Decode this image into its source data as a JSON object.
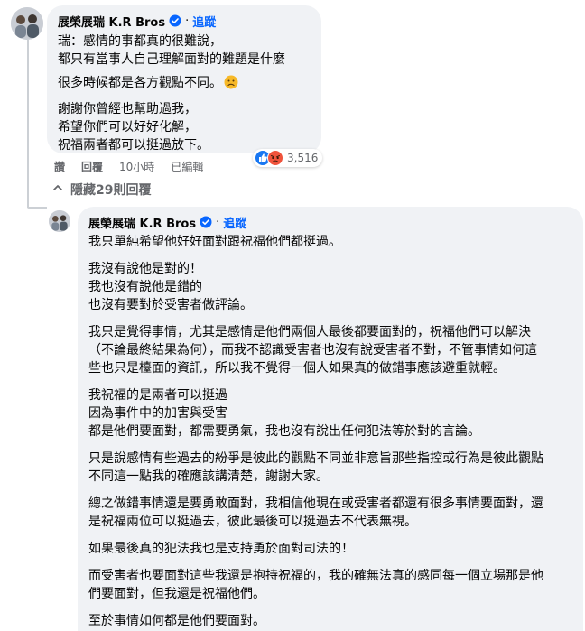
{
  "comment": {
    "author": "展榮展瑞 K.R Bros",
    "follow_label": "追蹤",
    "separator": "·",
    "paragraphs": [
      "瑞：感情的事都真的很難說，\n都只有當事人自己理解面對的難題是什麼",
      "很多時候都是各方觀點不同。",
      "謝謝你曾經也幫助過我，\n希望你們可以好好化解，\n祝福兩者都可以挺過放下。"
    ],
    "reaction_count": "3,516",
    "actions": [
      "讚",
      "回覆",
      "10小時",
      "已編輯"
    ]
  },
  "hidden_replies_label": "隱藏29則回覆",
  "reply": {
    "author": "展榮展瑞 K.R Bros",
    "follow_label": "追蹤",
    "separator": "·",
    "paragraphs": [
      "我只單純希望他好好面對跟祝福他們都挺過。",
      "我沒有說他是對的！\n我也沒有說他是錯的\n也沒有要對於受害者做評論。",
      "我只是覺得事情，尤其是感情是他們兩個人最後都要面對的，祝福他們可以解決\n（不論最終結果為何），而我不認識受害者也沒有說受害者不對，不管事情如何這\n些也只是檯面的資訊，所以我不覺得一個人如果真的做錯事應該避重就輕。",
      "我祝福的是兩者可以挺過\n因為事件中的加害與受害\n都是他們要面對，都需要勇氣，我也沒有說出任何犯法等於對的言論。",
      "只是說感情有些過去的紛爭是彼此的觀點不同並非意旨那些指控或行為是彼此觀點\n不同這一點我的確應該講清楚，謝謝大家。",
      "總之做錯事情還是要勇敢面對，我相信他現在或受害者都還有很多事情要面對，還\n是祝福兩位可以挺過去，彼此最後可以挺過去不代表無視。",
      "如果最後真的犯法我也是支持勇於面對司法的！",
      "而受害者也要面對這些我還是抱持祝福的，我的確無法真的感同每一個立場那是他\n們要面對，但我還是祝福他們。",
      "至於事情如何都是他們要面對。"
    ]
  },
  "colors": {
    "bubble": "#f0f2f5",
    "link": "#0866ff",
    "muted": "#65676b",
    "like": "#1877f2",
    "angry": "#f0533c"
  },
  "icons": {
    "avatar": "avatar-photo",
    "verified": "verified-badge-icon",
    "emoji": "sad-face-emoji",
    "like": "like-reaction-icon",
    "angry": "angry-reaction-icon",
    "chevron": "chevron-up-icon"
  }
}
